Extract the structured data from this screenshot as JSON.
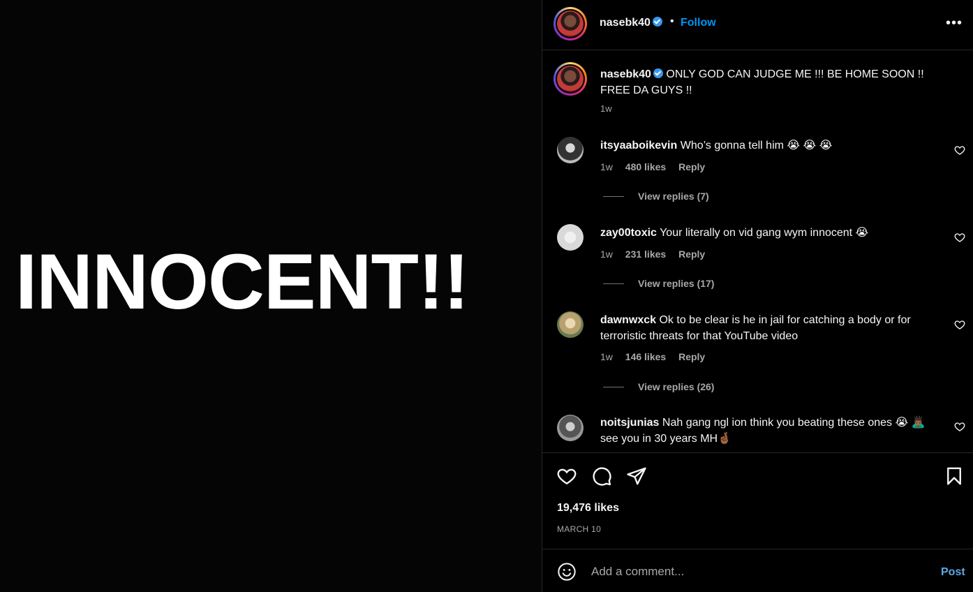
{
  "media": {
    "text": "INNOCENT!!"
  },
  "header": {
    "username": "nasebk40",
    "separator": "•",
    "follow_label": "Follow",
    "more_label": "•••"
  },
  "caption": {
    "username": "nasebk40",
    "text": "ONLY GOD CAN JUDGE ME !!! BE HOME SOON !! FREE DA GUYS !!",
    "time": "1w"
  },
  "comments": [
    {
      "username": "itsyaaboikevin",
      "text": "Who’s gonna tell him 😭 😭 😭",
      "time": "1w",
      "likes": "480 likes",
      "reply_label": "Reply",
      "view_replies": "View replies (7)"
    },
    {
      "username": "zay00toxic",
      "text": "Your literally on vid gang wym innocent 😭",
      "time": "1w",
      "likes": "231 likes",
      "reply_label": "Reply",
      "view_replies": "View replies (17)"
    },
    {
      "username": "dawnwxck",
      "text": "Ok to be clear is he in jail for catching a body or for terroristic threats for that YouTube video",
      "time": "1w",
      "likes": "146 likes",
      "reply_label": "Reply",
      "view_replies": "View replies (26)"
    },
    {
      "username": "noitsjunias",
      "text": "Nah gang ngl ion think you beating these ones 😭 🙇🏾‍♂️ see you in 30 years MH🤞🏾",
      "time": "",
      "likes": "",
      "reply_label": "",
      "view_replies": ""
    }
  ],
  "actions": {
    "likes": "19,476 likes",
    "date": "MARCH 10"
  },
  "composer": {
    "placeholder": "Add a comment...",
    "post_label": "Post"
  },
  "icons": {
    "like": "heart-icon",
    "comment": "comment-bubble-icon",
    "share": "paper-plane-icon",
    "save": "bookmark-icon",
    "emoji": "smiley-icon",
    "verified": "verified-badge-icon",
    "more": "more-horizontal-icon"
  },
  "colors": {
    "background": "#000000",
    "accent": "#0095f6",
    "muted": "#a8a8a8",
    "divider": "#262626"
  }
}
